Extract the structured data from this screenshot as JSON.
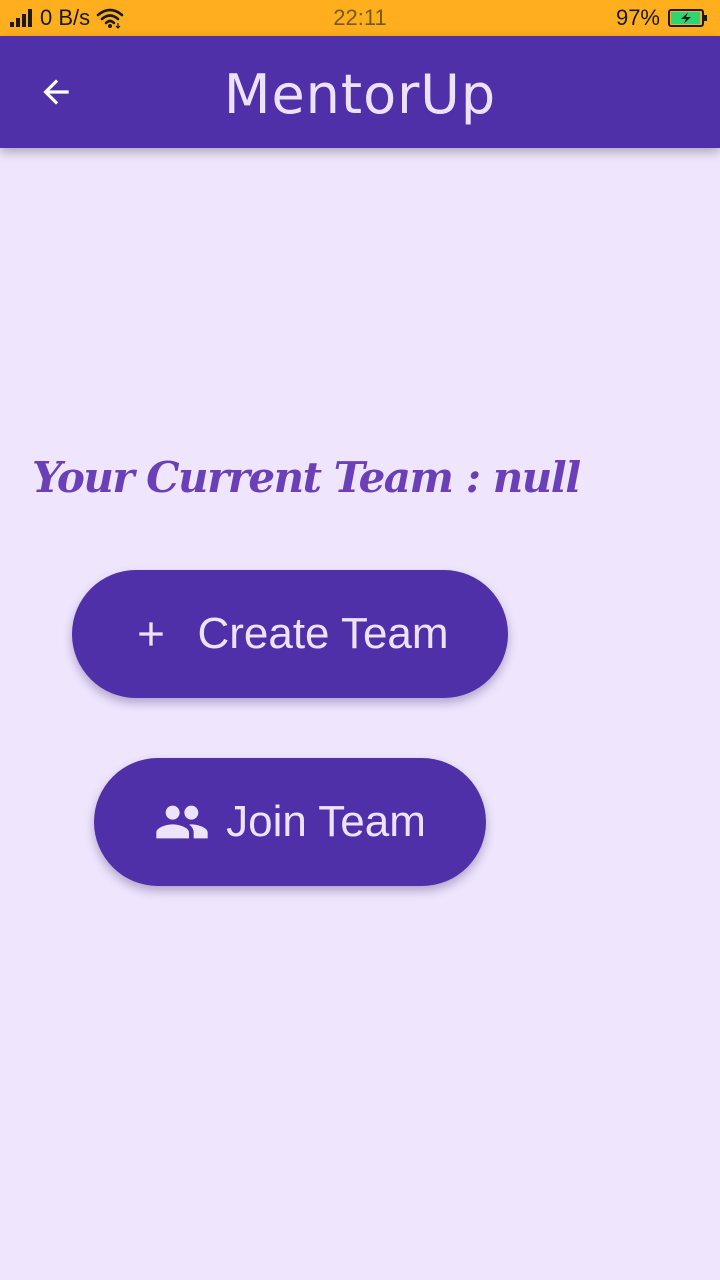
{
  "status_bar": {
    "net_speed": "0 B/s",
    "time": "22:11",
    "battery_percent": "97%",
    "battery_level": 0.97,
    "icons": [
      "signal-icon",
      "wifi-icon",
      "battery-charging-icon"
    ]
  },
  "app_bar": {
    "title": "MentorUp",
    "back_icon": "arrow-back-icon"
  },
  "main": {
    "current_team_text": "Your Current Team : null",
    "create_button": {
      "label": "Create Team",
      "icon": "plus-icon"
    },
    "join_button": {
      "label": "Join Team",
      "icon": "group-icon"
    }
  },
  "colors": {
    "status_bar": "#FFAE1E",
    "primary": "#5030A8",
    "background": "#EFE6FD",
    "heading_text": "#6A3FB8",
    "on_primary": "#EDE3FF"
  }
}
